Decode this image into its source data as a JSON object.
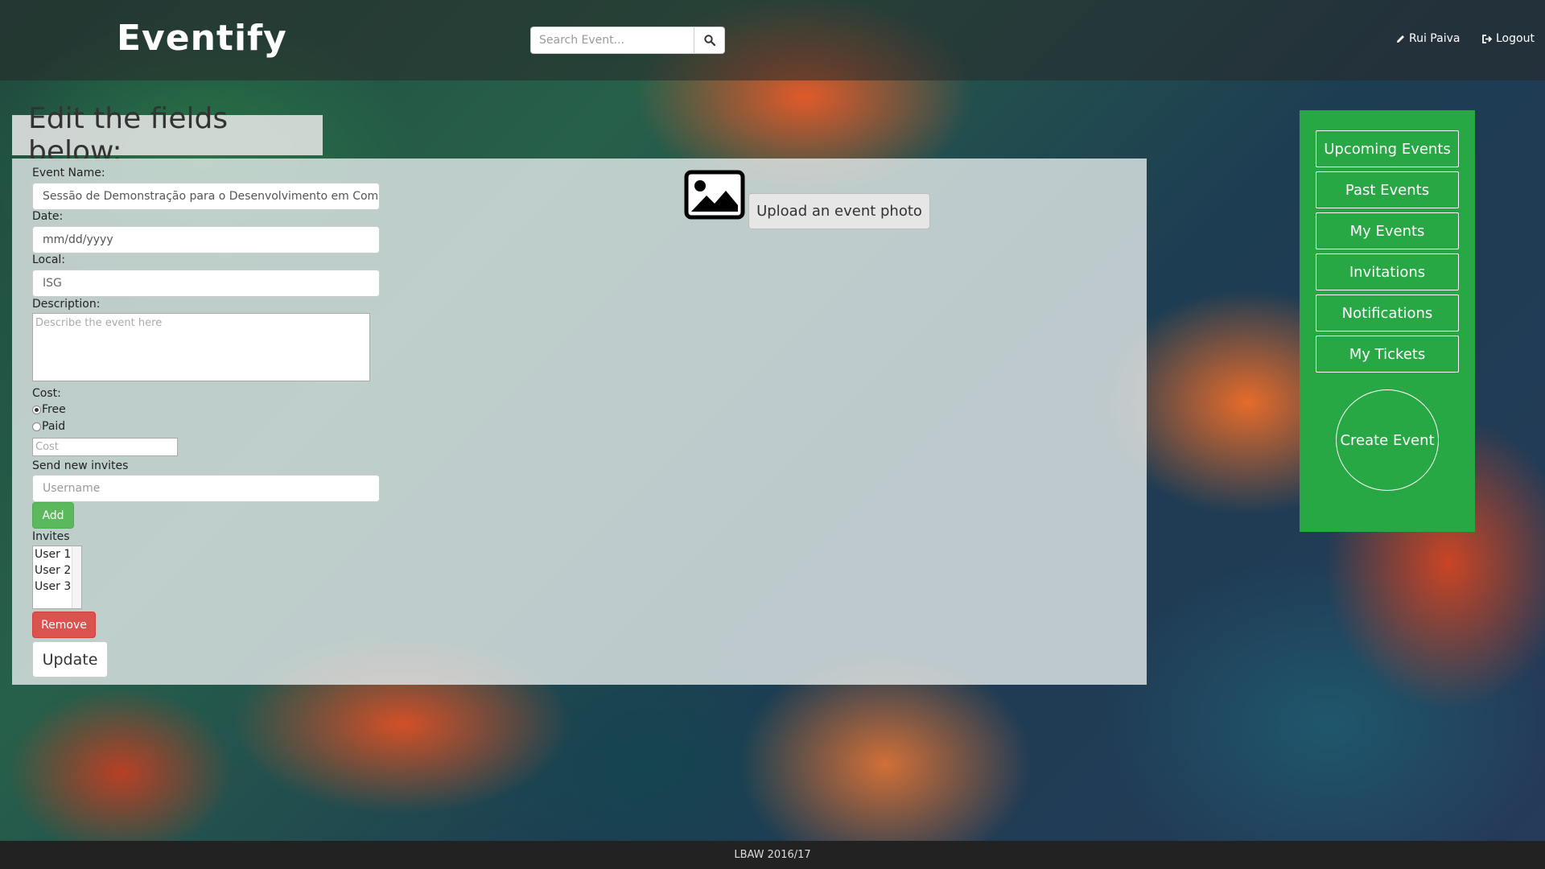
{
  "header": {
    "brand": "Eventify",
    "search": {
      "placeholder": "Search Event...",
      "value": ""
    },
    "user_name": "Rui Paiva",
    "logout_label": "Logout"
  },
  "form": {
    "heading": "Edit the fields below:",
    "event_name_label": "Event Name:",
    "event_name_value": "Sessão de Demonstração para o Desenvolvimento em Comunidade",
    "date_label": "Date:",
    "date_placeholder": "mm/dd/yyyy",
    "local_label": "Local:",
    "local_value": "ISG",
    "description_label": "Description:",
    "description_placeholder": "Describe the event here",
    "cost_label": "Cost:",
    "cost_options": [
      {
        "label": "Free",
        "checked": true
      },
      {
        "label": "Paid",
        "checked": false
      }
    ],
    "cost_placeholder": "Cost",
    "invites_label": "Send new invites",
    "username_placeholder": "Username",
    "add_label": "Add",
    "invites_list_label": "Invites",
    "invites": [
      "User 1",
      "User 2",
      "User 3"
    ],
    "remove_label": "Remove",
    "update_label": "Update",
    "upload_label": "Upload an event photo"
  },
  "sidebar": {
    "items": [
      {
        "label": "Upcoming Events"
      },
      {
        "label": "Past Events"
      },
      {
        "label": "My Events"
      },
      {
        "label": "Invitations"
      },
      {
        "label": "Notifications"
      },
      {
        "label": "My Tickets"
      }
    ],
    "create_label": "Create Event",
    "accent": "#28a745"
  },
  "footer": {
    "text": "LBAW 2016/17"
  }
}
